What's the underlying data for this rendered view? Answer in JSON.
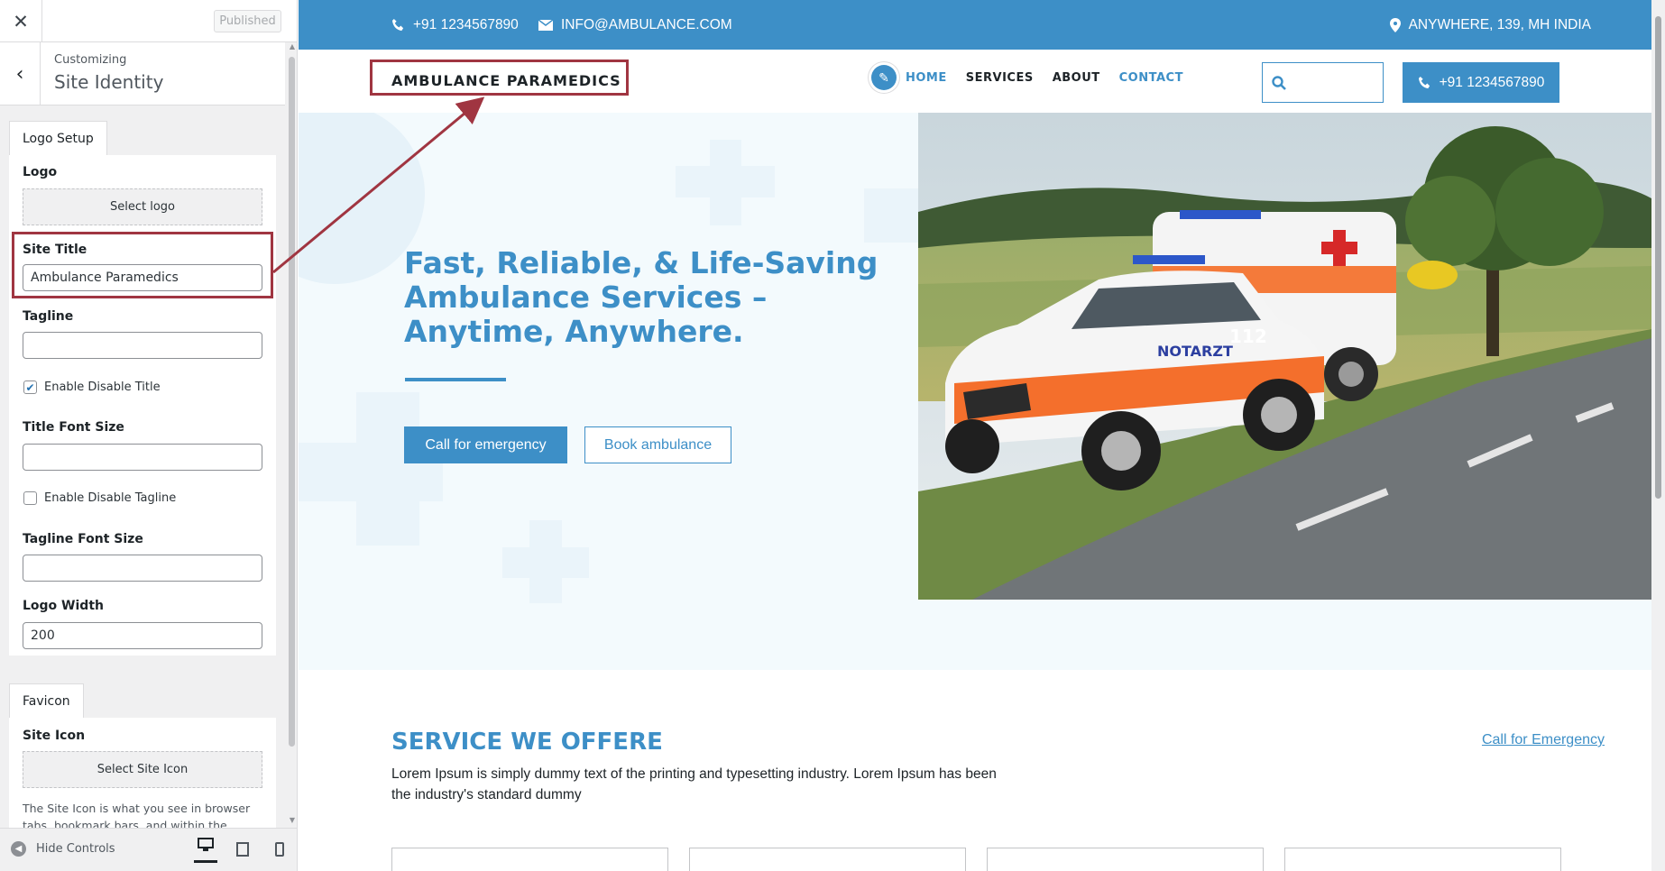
{
  "panel": {
    "published_label": "Published",
    "customizing_label": "Customizing",
    "section_title": "Site Identity",
    "logo_setup": {
      "tab_label": "Logo Setup",
      "logo_label": "Logo",
      "select_logo_label": "Select logo",
      "site_title_label": "Site Title",
      "site_title_value": "Ambulance Paramedics",
      "tagline_label": "Tagline",
      "tagline_value": "",
      "enable_disable_title_label": "Enable Disable Title",
      "enable_disable_title_checked": true,
      "title_font_size_label": "Title Font Size",
      "title_font_size_value": "",
      "enable_disable_tagline_label": "Enable Disable Tagline",
      "enable_disable_tagline_checked": false,
      "tagline_font_size_label": "Tagline Font Size",
      "tagline_font_size_value": "",
      "logo_width_label": "Logo Width",
      "logo_width_value": "200"
    },
    "favicon": {
      "tab_label": "Favicon",
      "site_icon_label": "Site Icon",
      "select_site_icon_label": "Select Site Icon",
      "description": "The Site Icon is what you see in browser tabs, bookmark bars, and within the WordPress"
    },
    "footer": {
      "hide_controls_label": "Hide Controls"
    }
  },
  "preview": {
    "topbar": {
      "phone": "+91 1234567890",
      "email": "INFO@AMBULANCE.COM",
      "address": "ANYWHERE, 139, MH INDIA"
    },
    "header": {
      "site_title": "AMBULANCE PARAMEDICS",
      "nav": [
        "HOME",
        "SERVICES",
        "ABOUT",
        "CONTACT"
      ],
      "call_label": "+91 1234567890"
    },
    "hero": {
      "headline": "Fast, Reliable, & Life-Saving Ambulance Services – Anytime, Anywhere.",
      "emergency_button": "Call for emergency",
      "book_button": "Book ambulance",
      "vehicle_text_1": "NOTARZT",
      "vehicle_text_2": "112"
    },
    "services": {
      "title": "SERVICE WE OFFERE",
      "link": "Call for Emergency",
      "description": "Lorem Ipsum is simply dummy text of the printing and typesetting industry. Lorem Ipsum has been the industry's standard dummy"
    }
  },
  "colors": {
    "accent": "#3d8fc7",
    "annotation": "#a03541",
    "panel_bg": "#f0f0f1"
  }
}
